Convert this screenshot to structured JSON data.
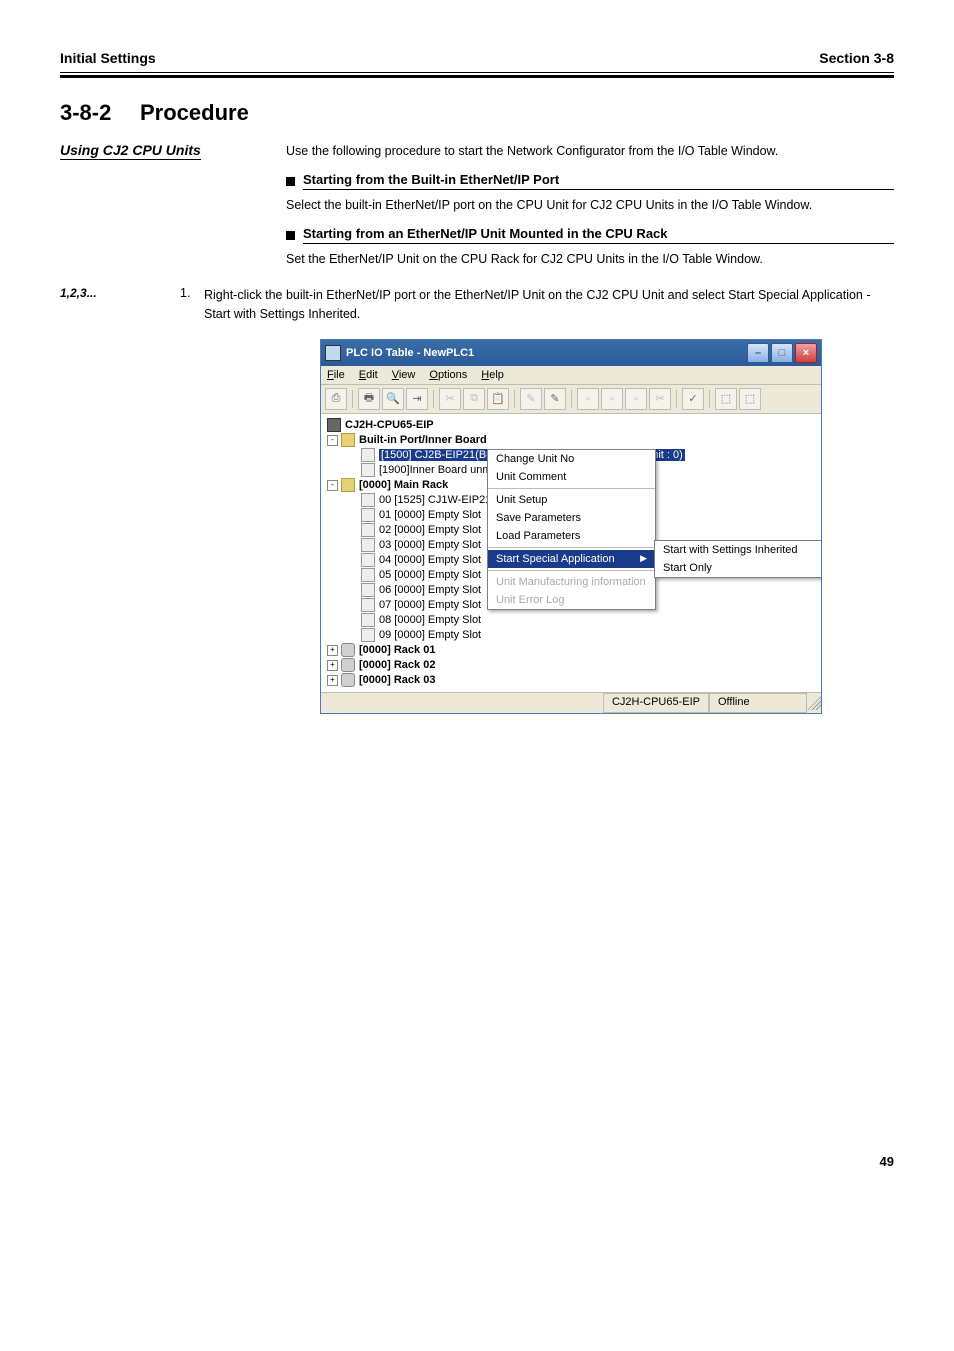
{
  "header": {
    "left": "Initial Settings",
    "right": "Section 3-8"
  },
  "section": {
    "number": "3-8-2",
    "title": "Procedure"
  },
  "side_heading": "Using CJ2 CPU Units",
  "intro_text": "Use the following procedure to start the Network Configurator from the I/O Table Window.",
  "sub1": {
    "heading": "Starting from the Built-in EtherNet/IP Port",
    "text": "Select the built-in EtherNet/IP port on the CPU Unit for CJ2 CPU Units in the I/O Table Window."
  },
  "sub2": {
    "heading": "Starting from an EtherNet/IP Unit Mounted in the CPU Rack",
    "text": "Set the EtherNet/IP Unit on the CPU Rack for CJ2 CPU Units in the I/O Table Window."
  },
  "step_text": "Right-click the built-in EtherNet/IP port or the EtherNet/IP Unit on the CJ2 CPU Unit and select Start Special Application - Start with Settings Inherited.",
  "step_marker": "1,2,3...",
  "step_num": "1.",
  "window": {
    "title": "PLC IO Table - NewPLC1",
    "menus": [
      "File",
      "Edit",
      "View",
      "Options",
      "Help"
    ],
    "tree": {
      "root": "CJ2H-CPU65-EIP",
      "inner_board": "Built-in Port/Inner Board",
      "selected_port": "[1500] CJ2B-EIP21(Built In EtherNet/IP Port for CJ2) (Unit : 0)",
      "inner_unmount": "[1900]Inner Board unm",
      "main_rack": "[0000] Main Rack",
      "slots": [
        "00 [1525] CJ1W-EIP21",
        "01 [0000] Empty Slot",
        "02 [0000] Empty Slot",
        "03 [0000] Empty Slot",
        "04 [0000] Empty Slot",
        "05 [0000] Empty Slot",
        "06 [0000] Empty Slot",
        "07 [0000] Empty Slot",
        "08 [0000] Empty Slot",
        "09 [0000] Empty Slot"
      ],
      "racks": [
        "[0000] Rack 01",
        "[0000] Rack 02",
        "[0000] Rack 03"
      ]
    },
    "context_menu": {
      "items": [
        {
          "label": "Change Unit No",
          "enabled": true
        },
        {
          "label": "Unit Comment",
          "enabled": true
        },
        {
          "label": "Unit Setup",
          "enabled": true
        },
        {
          "label": "Save Parameters",
          "enabled": true
        },
        {
          "label": "Load Parameters",
          "enabled": true
        },
        {
          "label": "Start Special Application",
          "enabled": true,
          "highlighted": true,
          "arrow": true
        },
        {
          "label": "Unit Manufacturing information",
          "enabled": false
        },
        {
          "label": "Unit Error Log",
          "enabled": false
        }
      ]
    },
    "submenu": {
      "items": [
        "Start with Settings Inherited",
        "Start Only"
      ]
    },
    "status": {
      "cpu": "CJ2H-CPU65-EIP",
      "mode": "Offline"
    }
  },
  "page_num": "49"
}
